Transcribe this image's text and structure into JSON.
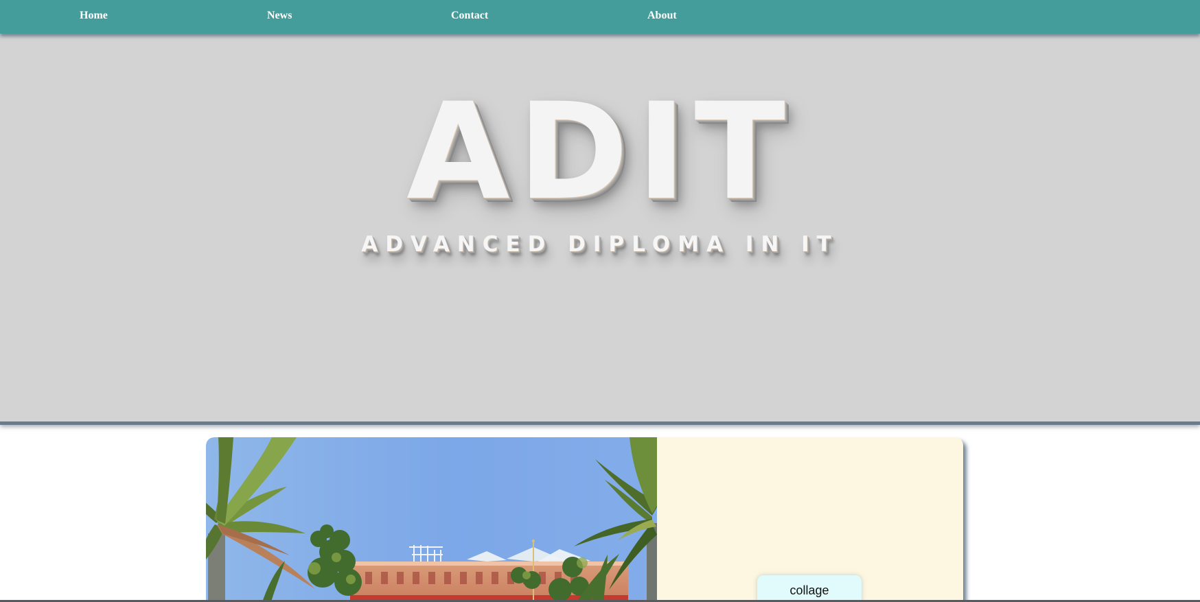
{
  "nav": {
    "home": "Home",
    "news": "News",
    "contact": "Contact",
    "about": "About"
  },
  "hero": {
    "title": "ADIT",
    "subtitle": "ADVANCED DIPLOMA IN IT"
  },
  "content": {
    "collage_label": "collage"
  },
  "colors": {
    "nav_background": "#449d9b",
    "hero_background": "#d3d3d3",
    "panel_background": "#fdf7e1",
    "button_background": "#e1fbfc"
  }
}
